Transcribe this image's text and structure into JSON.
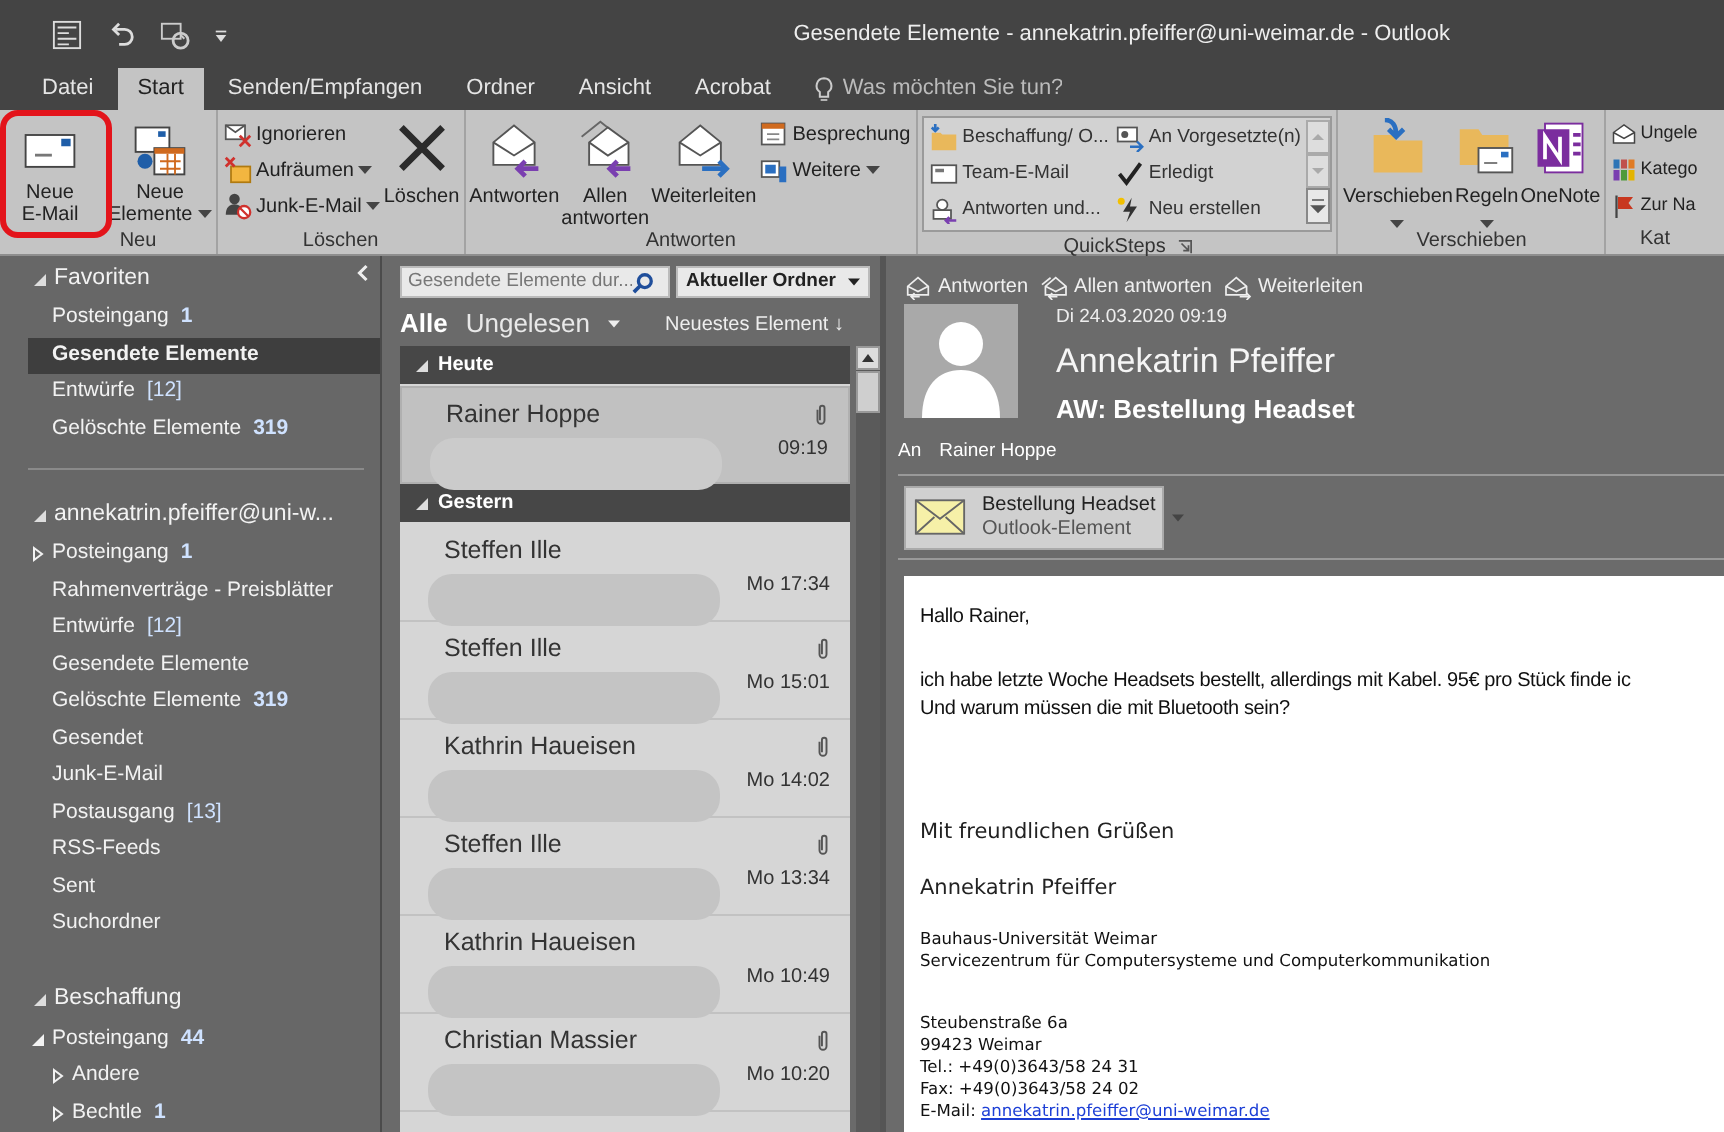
{
  "window": {
    "title": "Gesendete Elemente - annekatrin.pfeiffer@uni-weimar.de - Outlook"
  },
  "tabs": [
    {
      "label": "Datei",
      "selected": false
    },
    {
      "label": "Start",
      "selected": true
    },
    {
      "label": "Senden/Empfangen",
      "selected": false
    },
    {
      "label": "Ordner",
      "selected": false
    },
    {
      "label": "Ansicht",
      "selected": false
    },
    {
      "label": "Acrobat",
      "selected": false
    }
  ],
  "tell_me": {
    "placeholder": "Was möchten Sie tun?"
  },
  "ribbon": {
    "groups": [
      {
        "label": "Neu",
        "kind": "buttons",
        "items": [
          {
            "kind": "large",
            "label": "Neue\nE-Mail"
          },
          {
            "kind": "large",
            "label": "Neue\nElemente",
            "dropdown": true
          }
        ]
      },
      {
        "label": "Löschen",
        "kind": "buttons",
        "items": [
          {
            "kind": "small",
            "label": "Ignorieren"
          },
          {
            "kind": "small",
            "label": "Aufräumen",
            "dropdown": true
          },
          {
            "kind": "small",
            "label": "Junk-E-Mail",
            "dropdown": true
          },
          {
            "kind": "large",
            "label": "Löschen"
          }
        ]
      },
      {
        "label": "Antworten",
        "kind": "buttons",
        "items": [
          {
            "kind": "large",
            "label": "Antworten"
          },
          {
            "kind": "large",
            "label": "Allen\nantworten"
          },
          {
            "kind": "large",
            "label": "Weiterleiten"
          },
          {
            "kind": "small",
            "label": "Besprechung"
          },
          {
            "kind": "small",
            "label": "Weitere",
            "dropdown": true
          }
        ]
      },
      {
        "label": "QuickSteps",
        "kind": "gallery",
        "launcher": true,
        "items": [
          {
            "kind": "small",
            "label": "Beschaffung/ O..."
          },
          {
            "kind": "small",
            "label": "An Vorgesetzte(n)"
          },
          {
            "kind": "small",
            "label": "Team-E-Mail"
          },
          {
            "kind": "small",
            "label": "Erledigt"
          },
          {
            "kind": "small",
            "label": "Antworten und..."
          },
          {
            "kind": "small",
            "label": "Neu erstellen"
          }
        ]
      },
      {
        "label": "Verschieben",
        "kind": "buttons",
        "items": [
          {
            "kind": "split",
            "label": "Verschieben",
            "dropdown": true
          },
          {
            "kind": "split",
            "label": "Regeln",
            "dropdown": true
          },
          {
            "kind": "large",
            "label": "OneNote"
          }
        ]
      },
      {
        "label": "Kat",
        "kind": "buttons",
        "items": [
          {
            "kind": "small",
            "label": "Ungele"
          },
          {
            "kind": "small",
            "label": "Katego"
          },
          {
            "kind": "small",
            "label": "Zur Na"
          }
        ]
      }
    ]
  },
  "folders": {
    "sections": [
      {
        "label": "Favoriten",
        "expanded": true,
        "items": [
          {
            "label": "Posteingang",
            "unread": "1",
            "selected": false
          },
          {
            "label": "Gesendete Elemente",
            "selected": true
          },
          {
            "label": "Entwürfe",
            "total": "[12]",
            "selected": false
          },
          {
            "label": "Gelöschte Elemente",
            "unread": "319",
            "selected": false
          }
        ]
      },
      {
        "label": "annekatrin.pfeiffer@uni-w...",
        "expanded": true,
        "items": [
          {
            "label": "Posteingang",
            "unread": "1",
            "expanded": false,
            "selected": false
          },
          {
            "label": "Rahmenverträge - Preisblätter",
            "selected": false
          },
          {
            "label": "Entwürfe",
            "total": "[12]",
            "selected": false
          },
          {
            "label": "Gesendete Elemente",
            "selected": false
          },
          {
            "label": "Gelöschte Elemente",
            "unread": "319",
            "selected": false
          },
          {
            "label": "Gesendet",
            "selected": false
          },
          {
            "label": "Junk-E-Mail",
            "selected": false
          },
          {
            "label": "Postausgang",
            "total": "[13]",
            "selected": false
          },
          {
            "label": "RSS-Feeds",
            "selected": false
          },
          {
            "label": "Sent",
            "selected": false
          },
          {
            "label": "Suchordner",
            "selected": false
          }
        ]
      },
      {
        "label": "Beschaffung",
        "expanded": true,
        "items": [
          {
            "label": "Posteingang",
            "unread": "44",
            "expanded": true,
            "selected": false,
            "children": [
              {
                "label": "Andere",
                "expanded": false,
                "selected": false
              },
              {
                "label": "Bechtle",
                "unread": "1",
                "expanded": false,
                "selected": false
              }
            ]
          }
        ]
      }
    ]
  },
  "message_list": {
    "search": {
      "placeholder": "Gesendete Elemente dur..."
    },
    "scope": "Aktueller Ordner",
    "filters": [
      {
        "label": "Alle",
        "selected": true
      },
      {
        "label": "Ungelesen",
        "selected": false
      }
    ],
    "sort": "Neuestes Element ↓",
    "groups": [
      {
        "label": "Heute",
        "expanded": true,
        "messages": [
          {
            "sender": "Rainer Hoppe",
            "time": "09:19",
            "attachment": true,
            "selected": true
          }
        ]
      },
      {
        "label": "Gestern",
        "expanded": true,
        "messages": [
          {
            "sender": "Steffen Ille",
            "time": "Mo 17:34",
            "attachment": false,
            "selected": false
          },
          {
            "sender": "Steffen Ille",
            "time": "Mo 15:01",
            "attachment": true,
            "selected": false
          },
          {
            "sender": "Kathrin Haueisen",
            "time": "Mo 14:02",
            "attachment": true,
            "selected": false
          },
          {
            "sender": "Steffen Ille",
            "time": "Mo 13:34",
            "attachment": true,
            "selected": false
          },
          {
            "sender": "Kathrin Haueisen",
            "time": "Mo 10:49",
            "attachment": false,
            "selected": false
          },
          {
            "sender": "Christian Massier",
            "time": "Mo 10:20",
            "attachment": true,
            "selected": false
          }
        ]
      }
    ]
  },
  "reading_pane": {
    "actions": [
      "Antworten",
      "Allen antworten",
      "Weiterleiten"
    ],
    "date": "Di 24.03.2020 09:19",
    "sender": "Annekatrin Pfeiffer",
    "subject": "AW: Bestellung Headset",
    "to_label": "An",
    "to": "Rainer Hoppe",
    "attachment": {
      "name": "Bestellung Headset",
      "type": "Outlook-Element"
    },
    "body": [
      {
        "kind": "normal",
        "lines": [
          "Hallo Rainer,"
        ]
      },
      {
        "kind": "normal",
        "lines": [
          "ich habe letzte Woche Headsets bestellt, allerdings mit Kabel. 95€ pro Stück finde ic",
          "Und warum müssen die mit Bluetooth sein?"
        ]
      },
      {
        "kind": "closing",
        "lines": [
          "Mit freundlichen Grüßen"
        ]
      },
      {
        "kind": "closing",
        "lines": [
          "Annekatrin Pfeiffer"
        ]
      },
      {
        "kind": "small",
        "lines": [
          "Bauhaus-Universität Weimar",
          "Servicezentrum für Computersysteme und Computerkommunikation"
        ]
      },
      {
        "kind": "small",
        "lines": [
          "Steubenstraße 6a",
          "99423 Weimar",
          "Tel.: +49(0)3643/58 24 31",
          "Fax: +49(0)3643/58 24 02"
        ],
        "email": {
          "label": "E-Mail:",
          "link": "annekatrin.pfeiffer@uni-weimar.de"
        }
      }
    ]
  }
}
